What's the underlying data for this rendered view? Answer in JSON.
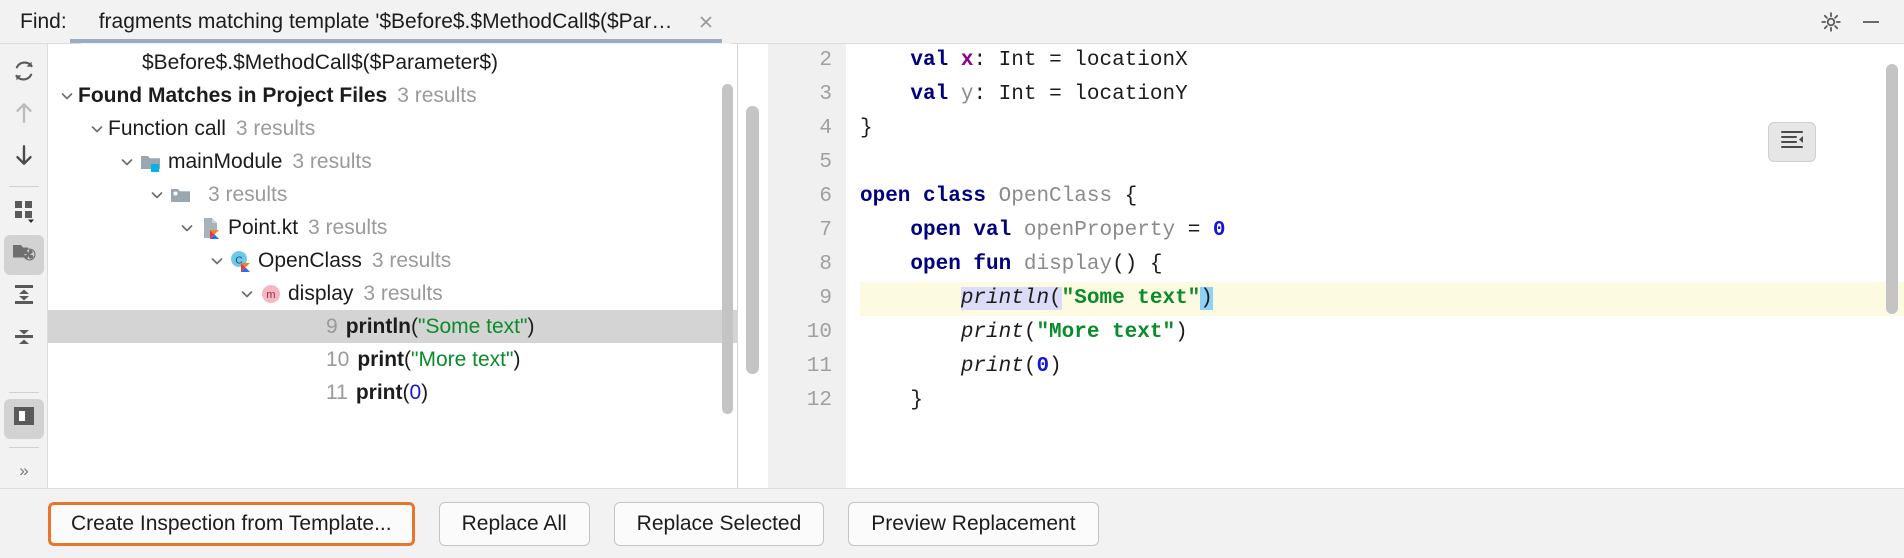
{
  "titlebar": {
    "find_label": "Find:",
    "tab_title": "fragments matching template '$Before$.$MethodCall$($Para...",
    "close_icon": "close-icon",
    "settings_icon": "gear-icon",
    "minimize_icon": "minimize-icon"
  },
  "toolbar": {
    "items": [
      {
        "name": "rerun-search",
        "icon": "refresh-icon",
        "state": "enabled"
      },
      {
        "name": "previous-occurrence",
        "icon": "arrow-up-icon",
        "state": "disabled"
      },
      {
        "name": "next-occurrence",
        "icon": "arrow-down-icon",
        "state": "enabled"
      },
      {
        "name": "group-by",
        "icon": "grid-dropdown-icon",
        "state": "enabled"
      },
      {
        "name": "filter-results",
        "icon": "folder-filter-icon",
        "state": "selected"
      },
      {
        "name": "expand-all",
        "icon": "expand-all-icon",
        "state": "enabled"
      },
      {
        "name": "collapse-all",
        "icon": "collapse-all-icon",
        "state": "enabled"
      },
      {
        "name": "toggle-preview",
        "icon": "preview-panel-icon",
        "state": "selected"
      }
    ],
    "overflow_label": "»"
  },
  "results_tree": {
    "rows": [
      {
        "id": "template-header",
        "indent": 4,
        "chevron": "",
        "icon": "",
        "label": "$Before$.$MethodCall$($Parameter$)",
        "count": "",
        "bold": false,
        "selected": false
      },
      {
        "id": "found-matches",
        "indent": 0,
        "chevron": "down",
        "icon": "",
        "label": "Found Matches in Project Files",
        "count": "3 results",
        "bold": true,
        "selected": false
      },
      {
        "id": "function-call",
        "indent": 1,
        "chevron": "down",
        "icon": "",
        "label": "Function call",
        "count": "3 results",
        "bold": false,
        "selected": false
      },
      {
        "id": "main-module",
        "indent": 2,
        "chevron": "down",
        "icon": "module-folder-icon",
        "label": "mainModule",
        "count": "3 results",
        "bold": false,
        "selected": false
      },
      {
        "id": "source-root",
        "indent": 3,
        "chevron": "down",
        "icon": "source-root-folder-icon",
        "label": "",
        "count": "3 results",
        "bold": false,
        "selected": false
      },
      {
        "id": "point-kt",
        "indent": 4,
        "chevron": "down",
        "icon": "kotlin-file-icon",
        "label": "Point.kt",
        "count": "3 results",
        "bold": false,
        "selected": false
      },
      {
        "id": "open-class",
        "indent": 5,
        "chevron": "down",
        "icon": "kotlin-class-icon",
        "label": "OpenClass",
        "count": "3 results",
        "bold": false,
        "selected": false
      },
      {
        "id": "display-method",
        "indent": 6,
        "chevron": "down",
        "icon": "method-icon",
        "label": "display",
        "count": "3 results",
        "bold": false,
        "selected": false
      }
    ],
    "matches": [
      {
        "id": "match-9",
        "line": "9",
        "call": "println",
        "string": "\"Some text\"",
        "selected": true
      },
      {
        "id": "match-10",
        "line": "10",
        "call": "print",
        "string": "\"More text\"",
        "selected": false
      },
      {
        "id": "match-11",
        "line": "11",
        "call": "print",
        "number": "0",
        "selected": false
      }
    ]
  },
  "editor": {
    "fold_icon": "fold-lines-icon",
    "lines": [
      {
        "num": "2",
        "highlight": false
      },
      {
        "num": "3",
        "highlight": false
      },
      {
        "num": "4",
        "highlight": false
      },
      {
        "num": "5",
        "highlight": false
      },
      {
        "num": "6",
        "highlight": false
      },
      {
        "num": "7",
        "highlight": false
      },
      {
        "num": "8",
        "highlight": false
      },
      {
        "num": "9",
        "highlight": true
      },
      {
        "num": "10",
        "highlight": false
      },
      {
        "num": "11",
        "highlight": false
      },
      {
        "num": "12",
        "highlight": false
      }
    ],
    "code": {
      "l2_kw": "val",
      "l2_name": "x",
      "l2_rest": ": Int = locationX",
      "l3_kw": "val",
      "l3_name": "y",
      "l3_type": ": Int = ",
      "l3_val": "locationY",
      "l4": "}",
      "l6_kw1": "open class",
      "l6_id": "OpenClass",
      "l6_brace": "{",
      "l7_kw": "open val",
      "l7_id": "openProperty",
      "l7_eq": " = ",
      "l7_num": "0",
      "l8_kw": "open fun",
      "l8_id": "display",
      "l8_rest": "() {",
      "l9_call": "println",
      "l9_open": "(",
      "l9_str": "\"Some text\"",
      "l9_close": ")",
      "l10_call": "print",
      "l10_open": "(",
      "l10_str": "\"More text\"",
      "l10_close": ")",
      "l11_call": "print",
      "l11_open": "(",
      "l11_num": "0",
      "l11_close": ")",
      "l12": "}"
    }
  },
  "buttons": {
    "create_inspection": "Create Inspection from Template...",
    "replace_all": "Replace All",
    "replace_selected": "Replace Selected",
    "preview_replacement": "Preview Replacement"
  },
  "colors": {
    "focus_ring": "#e8762a",
    "tab_underline": "#9aabc4",
    "selection": "#d4d4d4",
    "line_highlight": "#fdfae2",
    "keyword": "#000080",
    "string": "#0a8c2a",
    "number": "#1616d6"
  }
}
